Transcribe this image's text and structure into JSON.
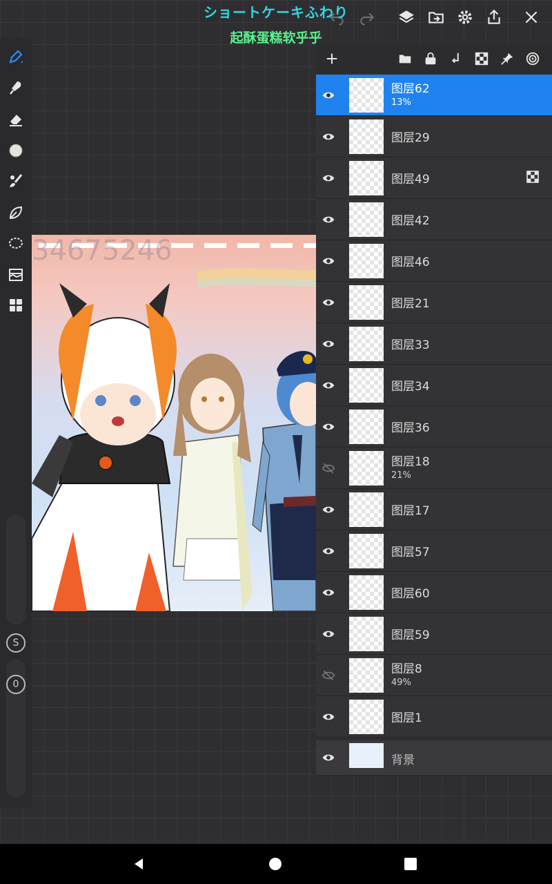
{
  "overlay": {
    "title": "ショートケーキふわり",
    "subtitle": "起酥蛋糕软乎乎"
  },
  "topbar": {
    "icons": [
      "undo-icon",
      "redo-icon",
      "layers-icon",
      "import-export-icon",
      "gear-icon",
      "share-icon",
      "close-icon"
    ]
  },
  "left_toolbar": {
    "tools": [
      "pen-tool-icon",
      "smudge-icon",
      "eraser-icon",
      "color-circle-icon",
      "brush-tool-icon",
      "leaf-icon",
      "lasso-icon",
      "layer-adjust-icon",
      "grid-apps-icon"
    ],
    "size_label": "S",
    "opacity_label": "0"
  },
  "canvas": {
    "watermark": "34675246"
  },
  "layer_panel": {
    "toolbar_icons": [
      "add-layer-icon",
      "folder-icon",
      "lock-icon",
      "merge-down-icon",
      "clipping-icon",
      "pin-icon",
      "layer-settings-icon"
    ],
    "layers": [
      {
        "name": "图层62",
        "opacity": "13%",
        "visible": true,
        "selected": true
      },
      {
        "name": "图层29",
        "opacity": "",
        "visible": true,
        "selected": false
      },
      {
        "name": "图层49",
        "opacity": "",
        "visible": true,
        "selected": false,
        "extra_icon": "checker-icon"
      },
      {
        "name": "图层42",
        "opacity": "",
        "visible": true,
        "selected": false
      },
      {
        "name": "图层46",
        "opacity": "",
        "visible": true,
        "selected": false
      },
      {
        "name": "图层21",
        "opacity": "",
        "visible": true,
        "selected": false
      },
      {
        "name": "图层33",
        "opacity": "",
        "visible": true,
        "selected": false
      },
      {
        "name": "图层34",
        "opacity": "",
        "visible": true,
        "selected": false
      },
      {
        "name": "图层36",
        "opacity": "",
        "visible": true,
        "selected": false
      },
      {
        "name": "图层18",
        "opacity": "21%",
        "visible": false,
        "selected": false
      },
      {
        "name": "图层17",
        "opacity": "",
        "visible": true,
        "selected": false
      },
      {
        "name": "图层57",
        "opacity": "",
        "visible": true,
        "selected": false
      },
      {
        "name": "图层60",
        "opacity": "",
        "visible": true,
        "selected": false
      },
      {
        "name": "图层59",
        "opacity": "",
        "visible": true,
        "selected": false
      },
      {
        "name": "图层8",
        "opacity": "49%",
        "visible": false,
        "selected": false
      },
      {
        "name": "图层1",
        "opacity": "",
        "visible": true,
        "selected": false
      }
    ],
    "background_layer": {
      "name": "背景",
      "visible": true
    }
  },
  "navbar": {
    "buttons": [
      "back-icon",
      "home-icon",
      "recents-icon"
    ]
  },
  "colors": {
    "accent": "#1f82ee",
    "title_cyan": "#31d6e6",
    "subtitle_green": "#5cf08f"
  }
}
